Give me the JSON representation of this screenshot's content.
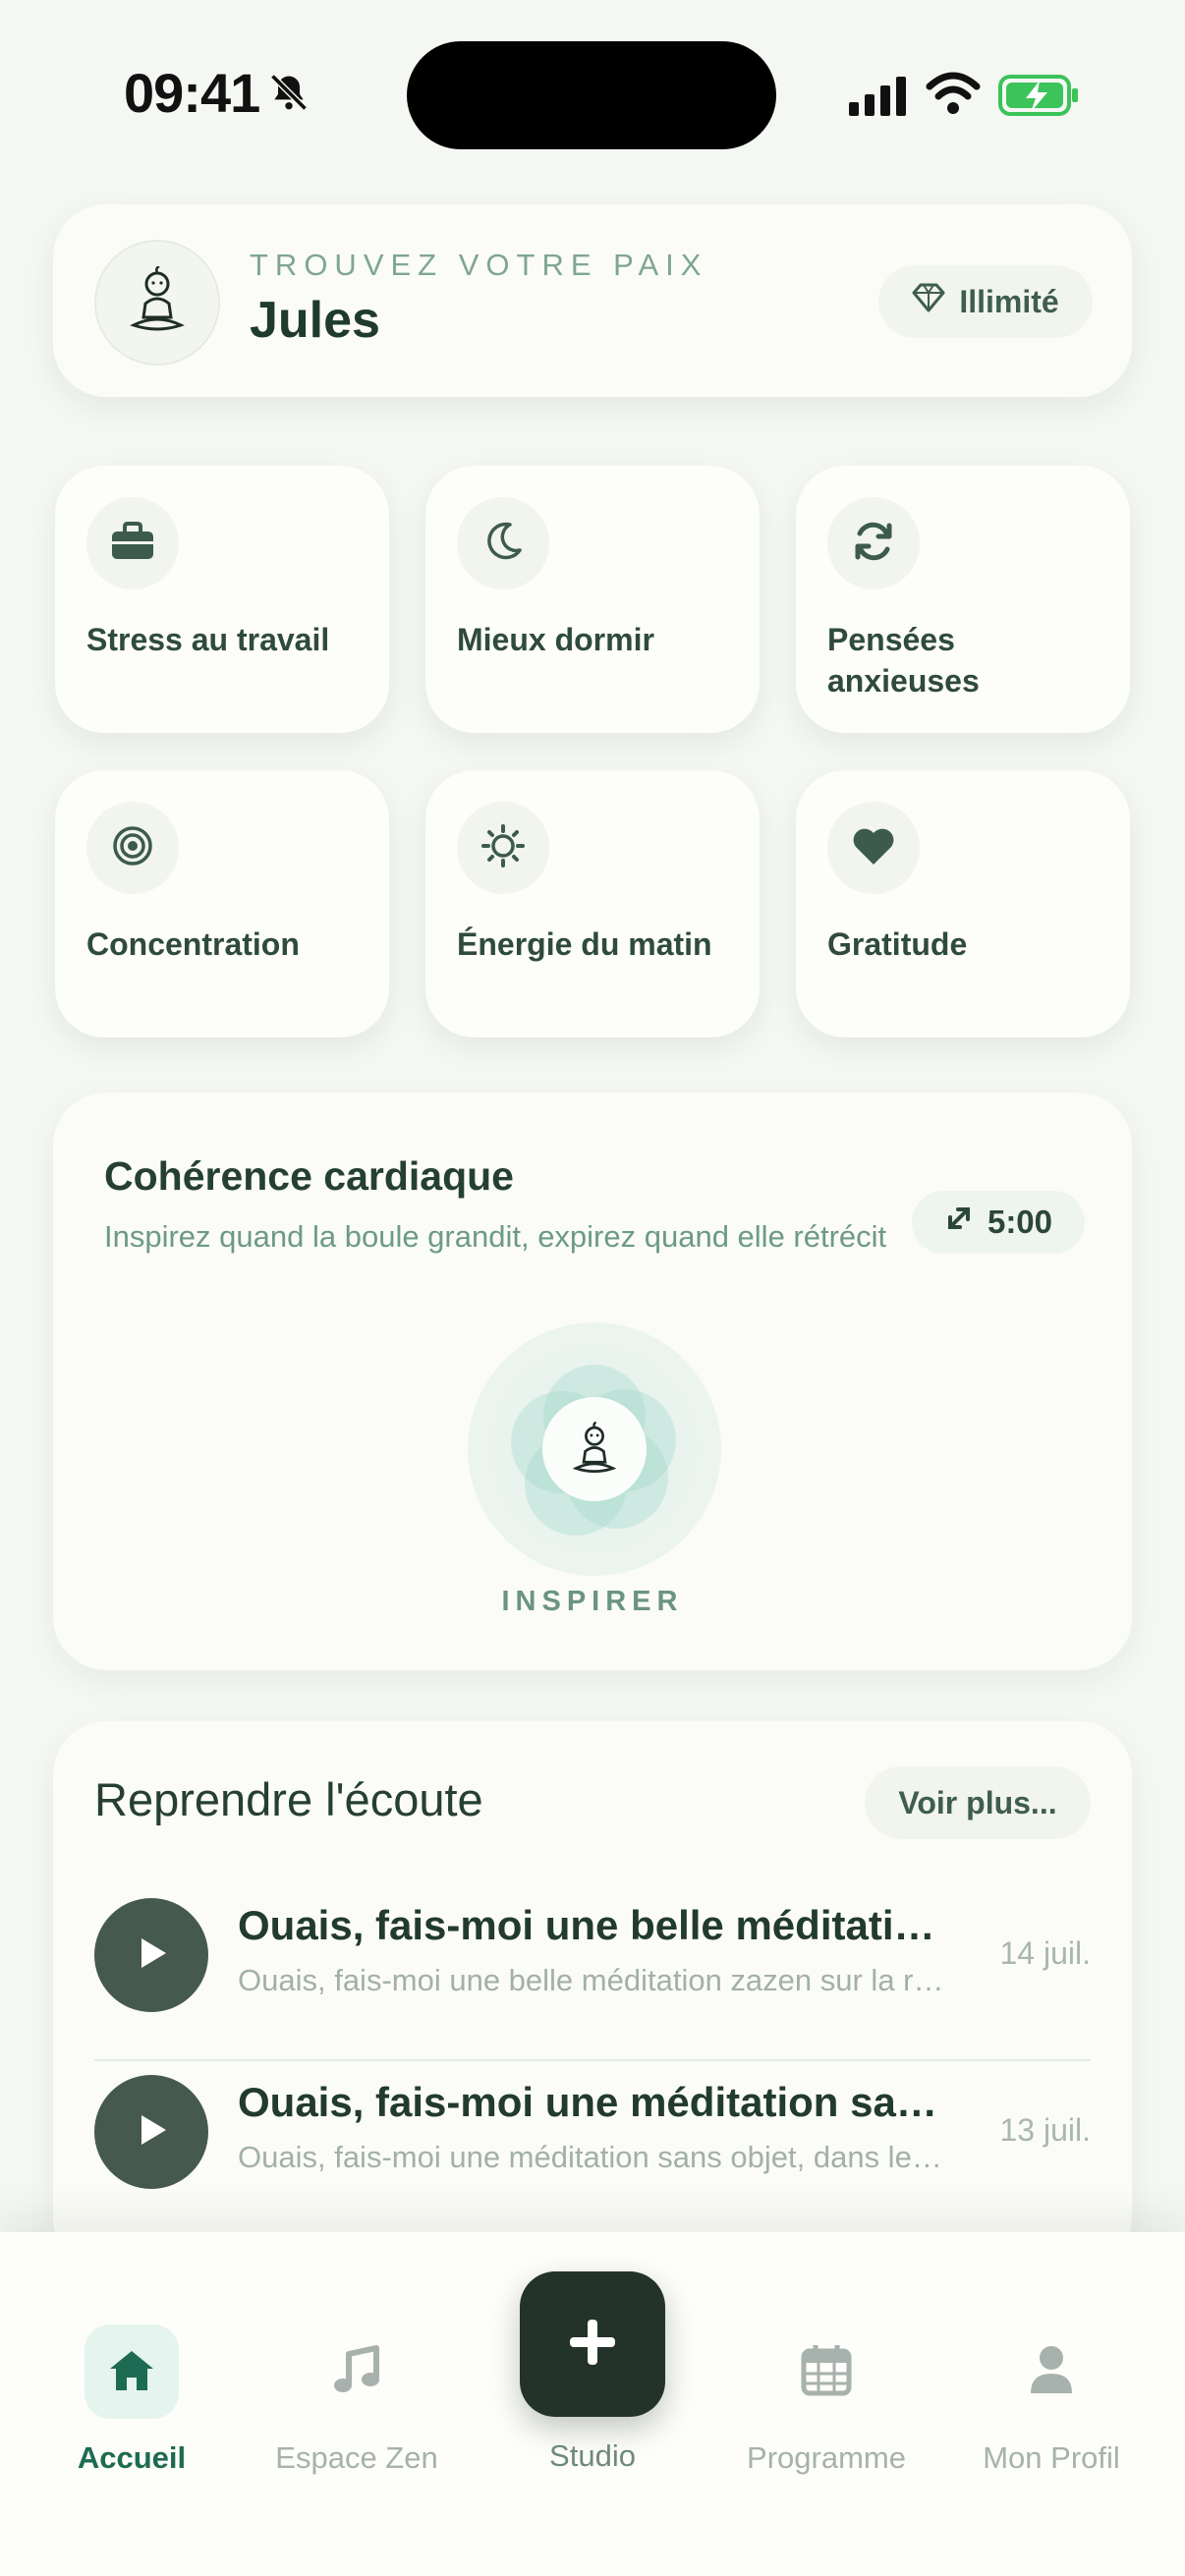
{
  "status_bar": {
    "time": "09:41"
  },
  "header": {
    "eyebrow": "TROUVEZ VOTRE PAIX",
    "user_name": "Jules",
    "plan_label": "Illimité"
  },
  "themes": [
    {
      "label": "Stress au travail",
      "icon": "briefcase-icon"
    },
    {
      "label": "Mieux dormir",
      "icon": "moon-icon"
    },
    {
      "label": "Pensées anxieuses",
      "icon": "refresh-icon"
    },
    {
      "label": "Concentration",
      "icon": "target-icon"
    },
    {
      "label": "Énergie du matin",
      "icon": "sun-icon"
    },
    {
      "label": "Gratitude",
      "icon": "heart-icon"
    }
  ],
  "coherence": {
    "title": "Cohérence cardiaque",
    "subtitle": "Inspirez quand la boule grandit, expirez quand elle rétrécit",
    "duration": "5:00",
    "phase": "INSPIRER"
  },
  "resume": {
    "title": "Reprendre l'écoute",
    "more_label": "Voir plus...",
    "items": [
      {
        "title": "Ouais, fais-moi une belle méditation zazen sur la respiration",
        "subtitle": "Ouais, fais-moi une belle méditation zazen sur la respiration",
        "date": "14 juil."
      },
      {
        "title": "Ouais, fais-moi une méditation sans objet, dans le silence",
        "subtitle": "Ouais, fais-moi une méditation sans objet, dans le silence",
        "date": "13 juil."
      }
    ]
  },
  "nav": {
    "items": [
      {
        "label": "Accueil",
        "icon": "home-icon",
        "active": true
      },
      {
        "label": "Espace Zen",
        "icon": "music-icon",
        "active": false
      },
      {
        "label": "Studio",
        "icon": "plus-icon",
        "active": false
      },
      {
        "label": "Programme",
        "icon": "calendar-icon",
        "active": false
      },
      {
        "label": "Mon Profil",
        "icon": "user-icon",
        "active": false
      }
    ]
  },
  "colors": {
    "accent": "#1d6b52",
    "battery": "#3cc35a",
    "dark_button": "#233329"
  }
}
